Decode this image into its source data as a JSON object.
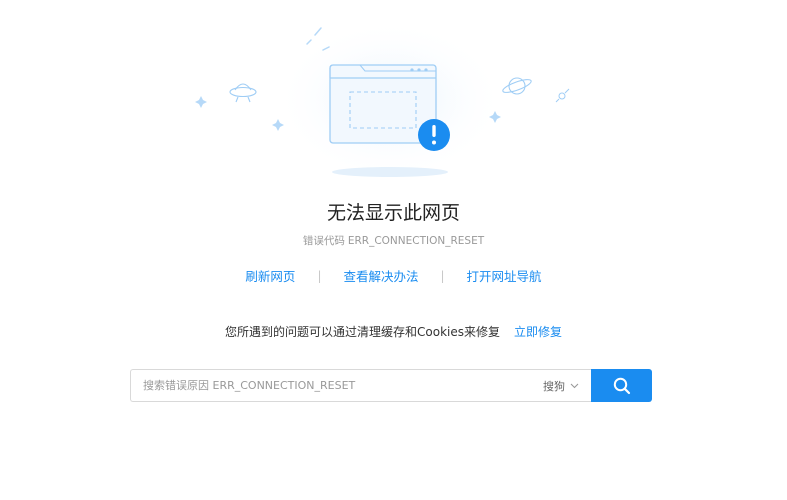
{
  "page": {
    "title": "无法显示此网页",
    "error_label": "错误代码",
    "error_code": "ERR_CONNECTION_RESET"
  },
  "links": [
    {
      "label": "刷新网页"
    },
    {
      "label": "查看解决办法"
    },
    {
      "label": "打开网址导航"
    }
  ],
  "link_separator": "|",
  "fix": {
    "message": "您所遇到的问题可以通过清理缓存和Cookies来修复",
    "action": "立即修复"
  },
  "search": {
    "placeholder": "搜索错误原因 ERR_CONNECTION_RESET",
    "value": "",
    "engine": "搜狗"
  },
  "colors": {
    "accent": "#1a8cf0",
    "title": "#222222",
    "muted": "#999999",
    "illustration_light": "#e8f3fd"
  },
  "icons": {
    "illustration": "browser-window-error-icon",
    "search": "search-icon",
    "engine_toggle": "chevron-down-icon"
  }
}
